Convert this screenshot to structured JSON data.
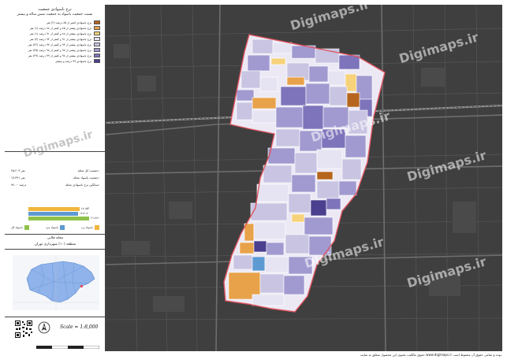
{
  "legend": {
    "title": "نرخ باسوادی جمعیت",
    "subtitle": "نسبت جمعیت باسواد به جمعیت شش ساله و بیشتر",
    "items": [
      {
        "label": "نرخ باسوادی کمتر از ۸۵ درصد (۲) نفر",
        "color": "#b5651d"
      },
      {
        "label": "نرخ باسوادی بیشتر از ۸۵ و کمتر از ۸۸ درصد (۱) نفر",
        "color": "#e8a24a"
      },
      {
        "label": "نرخ باسوادی بیشتر از ۸۸ و کمتر از ۹۱ درصد (۱) نفر",
        "color": "#f6d27a"
      },
      {
        "label": "نرخ باسوادی بیشتر از ۹۱ و کمتر از ۹۴ درصد (۳) نفر",
        "color": "#e6e4f2"
      },
      {
        "label": "نرخ باسوادی بیشتر از ۹۴ و کمتر از ۹۷ درصد (۲۲) نفر",
        "color": "#c8c4e2"
      },
      {
        "label": "نرخ باسوادی بیشتر از ۹۷ و کمتر از ۹۸ درصد (۴۵) نفر",
        "color": "#a19ad0"
      },
      {
        "label": "نرخ باسوادی بیشتر از ۹۸ و کمتر از ۹۹ درصد (۳۹) نفر",
        "color": "#7e74bb"
      },
      {
        "label": "نرخ باسوادی ۹۹ درصد و بیشتر",
        "color": "#4b3f8f"
      }
    ]
  },
  "stats": {
    "rows": [
      {
        "label": "جمعیت کل محله:",
        "value": "۲۵،۲۰۳ نفر"
      },
      {
        "label": "جمعیت باسواد محله:",
        "value": "۱۷،۳۴۱ نفر"
      },
      {
        "label": "میانگین نرخ باسوادی محله:",
        "value": "۹۶،۰۰ درصد"
      }
    ],
    "bars": [
      {
        "value": "۱۸،۱۵۳",
        "fraction": 0.72,
        "color": "#f2b53c"
      },
      {
        "value": "۱۷،۷۰۸",
        "fraction": 0.7,
        "color": "#5d9ad1"
      },
      {
        "value": "۲۱،۷۶۱",
        "fraction": 0.86,
        "color": "#8fc24a"
      }
    ],
    "bar_legend": [
      {
        "label": "باسواد کل",
        "color": "#8fc24a"
      },
      {
        "label": "باسواد مرد",
        "color": "#5d9ad1"
      },
      {
        "label": "باسواد زن",
        "color": "#f2b53c"
      }
    ]
  },
  "region": {
    "name": "محله قلابی",
    "district": "منطقه (۱۰) شهرداری تهران"
  },
  "scale": {
    "text": "Scale = 1:8,000"
  },
  "watermarks": [
    "Digimaps.ir",
    "Digimaps.ir",
    "Digimaps.ir",
    "Digimaps.ir",
    "Digimaps.ir",
    "Digimaps.ir",
    "Digimaps.ir"
  ],
  "footer": "حقوق مالکیت معنوی این محصول متعلق به سایت www.digimaps.ir بوده و تمامی حقوق آن محفوظ است.",
  "colors": {
    "boundary": "#e05560",
    "map_background": "#3f3f3f"
  }
}
